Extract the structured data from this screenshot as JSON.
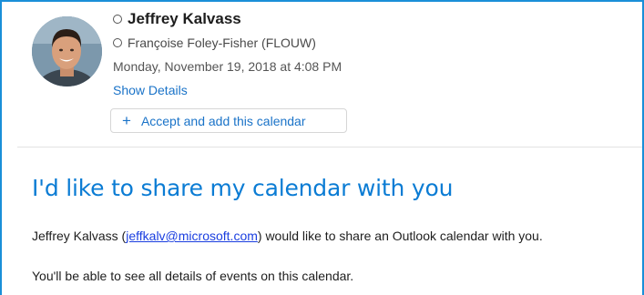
{
  "sender": {
    "name": "Jeffrey Kalvass",
    "avatar_icon": "person-photo-icon"
  },
  "recipient": {
    "label": "Françoise Foley-Fisher (FLOUW)"
  },
  "date": "Monday, November 19, 2018 at 4:08 PM",
  "show_details": "Show Details",
  "accept_button": {
    "icon": "plus-icon",
    "icon_glyph": "+",
    "label": "Accept and add this calendar"
  },
  "message": {
    "headline": "I'd like to share my calendar with you",
    "line1_prefix": "Jeffrey Kalvass (",
    "line1_email": "jeffkalv@microsoft.com",
    "line1_suffix": ") would like to share an Outlook calendar with you.",
    "line2": "You'll be able to see all details of events on this calendar."
  },
  "colors": {
    "accent_border": "#1a8fd8",
    "link_blue": "#1a73c8",
    "headline_blue": "#0b7cd4",
    "email_link": "#1a3ee0"
  }
}
